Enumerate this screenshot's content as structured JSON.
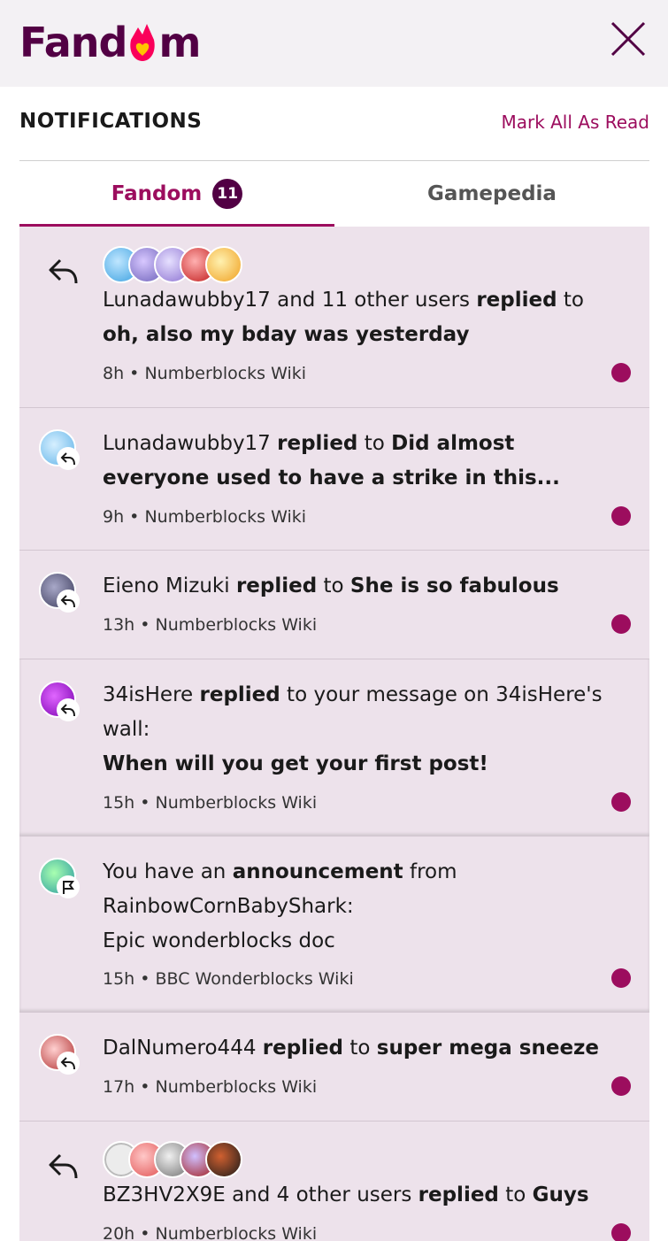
{
  "header": {
    "logo_prefix": "Fand",
    "logo_suffix": "m",
    "close_icon": "close-icon",
    "brand_color": "#520044",
    "accent_color": "#9c0d5e"
  },
  "panel": {
    "title": "NOTIFICATIONS",
    "mark_all": "Mark All As Read"
  },
  "tabs": [
    {
      "label": "Fandom",
      "badge": "11",
      "active": true
    },
    {
      "label": "Gamepedia",
      "active": false
    }
  ],
  "notifications": [
    {
      "actor": "Lunadawubby17",
      "mid": " and 11 other users ",
      "action": "replied",
      "connector": " to ",
      "target": "oh, also my bday was yesterday",
      "time": "8h",
      "wiki": "Numberblocks Wiki",
      "icon": "reply-icon"
    },
    {
      "actor": "Lunadawubby17",
      "action": "replied",
      "connector": " to ",
      "target": "Did almost everyone used to have a strike in this...",
      "time": "9h",
      "wiki": "Numberblocks Wiki",
      "icon": "reply-icon"
    },
    {
      "actor": "Eieno Mizuki",
      "action": "replied",
      "connector": " to ",
      "target": "She is so fabulous",
      "time": "13h",
      "wiki": "Numberblocks Wiki",
      "icon": "reply-icon"
    },
    {
      "actor": "34isHere",
      "action": "replied",
      "connector": " to your message on 34isHere's wall:",
      "target": "When will you get your first post!",
      "time": "15h",
      "wiki": "Numberblocks Wiki",
      "icon": "reply-icon"
    },
    {
      "prefix": "You have an ",
      "action": "announcement",
      "connector": " from",
      "actor": "RainbowCornBabyShark:",
      "target": "Epic wonderblocks doc",
      "time": "15h",
      "wiki": "BBC Wonderblocks Wiki",
      "icon": "flag-icon"
    },
    {
      "actor": "DalNumero444",
      "action": "replied",
      "connector": " to ",
      "target": "super mega sneeze",
      "time": "17h",
      "wiki": "Numberblocks Wiki",
      "icon": "reply-icon"
    },
    {
      "actor": "BZ3HV2X9E",
      "mid": " and 4 other users ",
      "action": "replied",
      "connector": " to ",
      "target": "Guys",
      "time": "20h",
      "wiki": "Numberblocks Wiki",
      "icon": "reply-icon"
    }
  ],
  "meta_separator": " • "
}
